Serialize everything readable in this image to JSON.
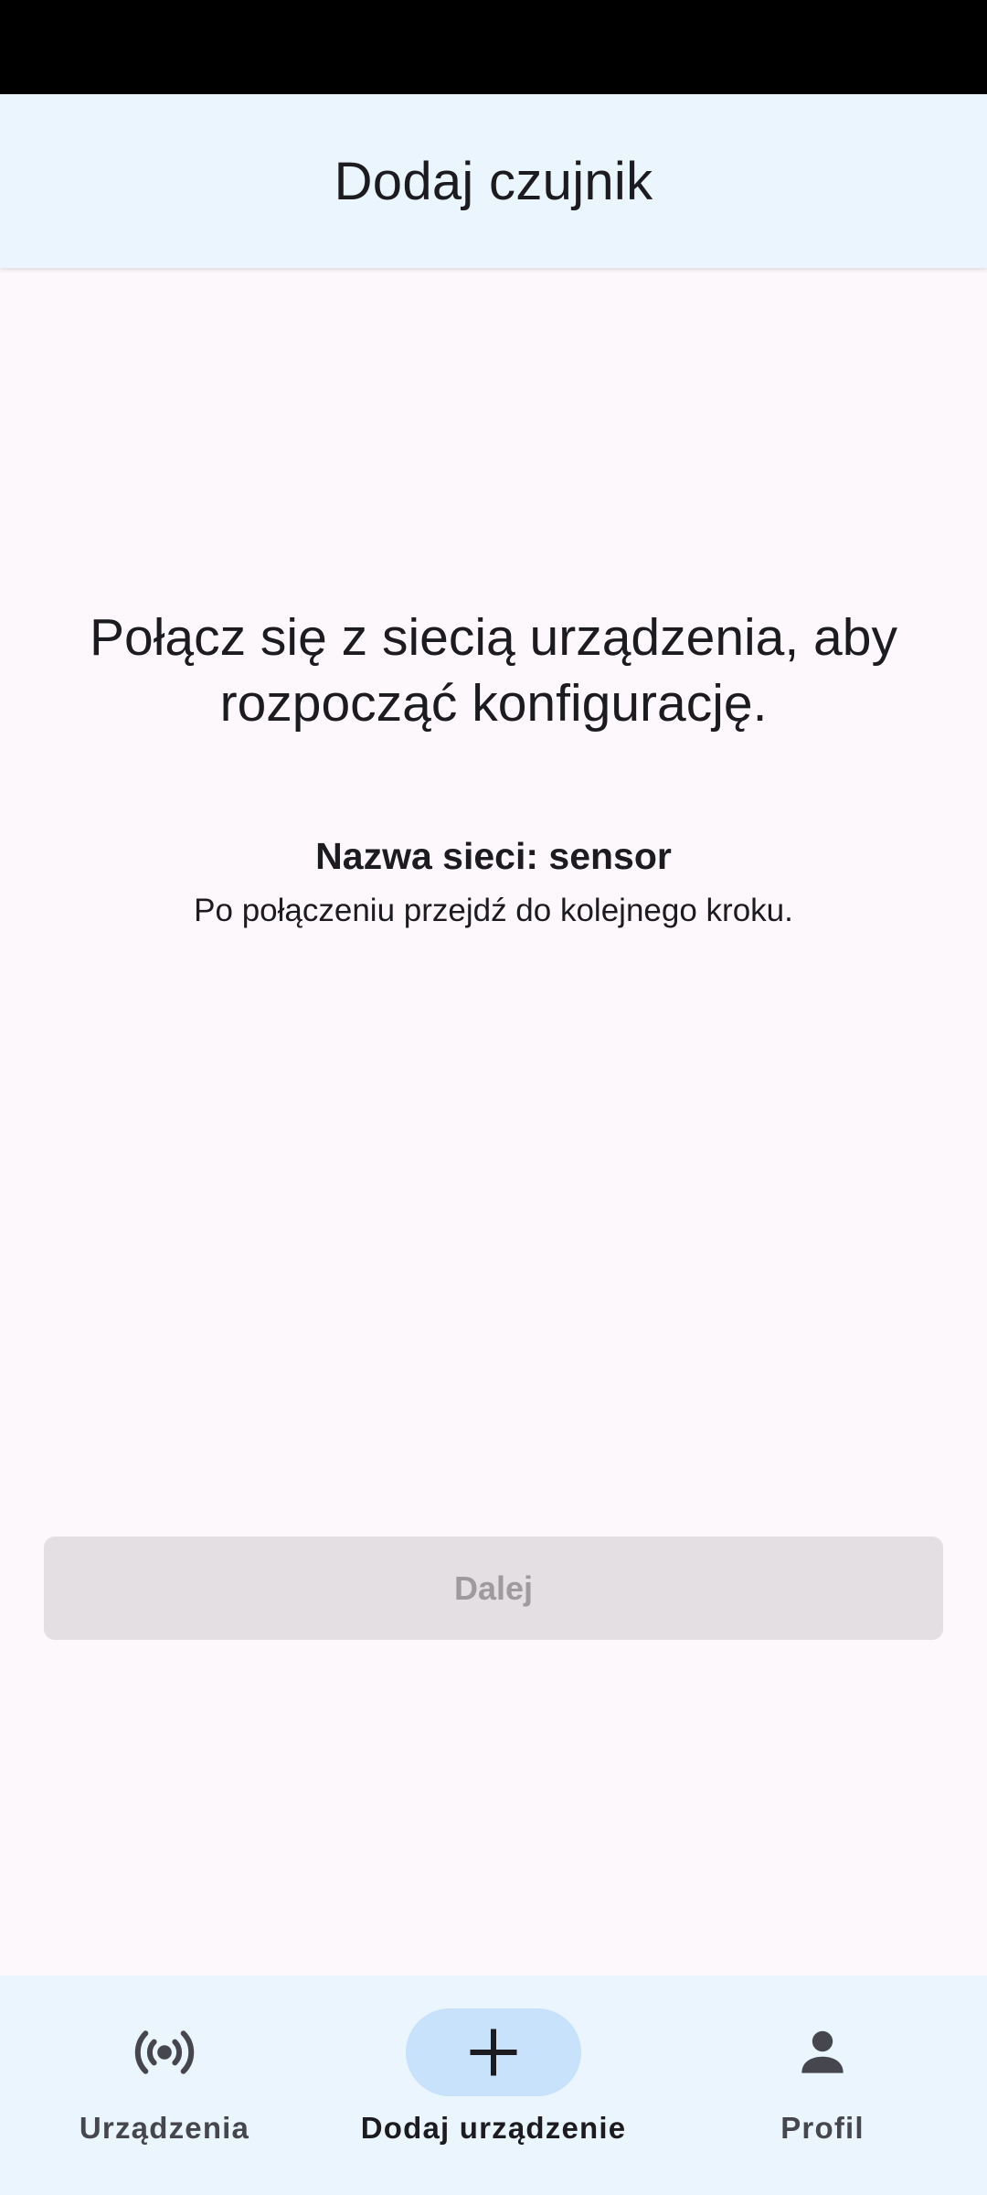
{
  "app_bar": {
    "title": "Dodaj czujnik"
  },
  "main": {
    "headline": "Połącz się z siecią urządzenia, aby rozpocząć konfigurację.",
    "network_name": "Nazwa sieci: sensor",
    "hint": "Po połączeniu przejdź do kolejnego kroku.",
    "next_button": {
      "label": "Dalej",
      "enabled": false
    }
  },
  "bottom_nav": {
    "items": [
      {
        "label": "Urządzenia",
        "icon": "sensors-icon",
        "active": false
      },
      {
        "label": "Dodaj urządzenie",
        "icon": "add-icon",
        "active": true
      },
      {
        "label": "Profil",
        "icon": "person-icon",
        "active": false
      }
    ]
  },
  "colors": {
    "status_bar": "#000000",
    "app_bar_bg": "#eaf5fd",
    "page_bg": "#fdf8fc",
    "text": "#1c1b1f",
    "disabled_button_bg": "#e3dfe3",
    "disabled_button_text": "#9e9a9e",
    "nav_active_indicator": "#c7e2fa",
    "nav_icon": "#46464f"
  }
}
